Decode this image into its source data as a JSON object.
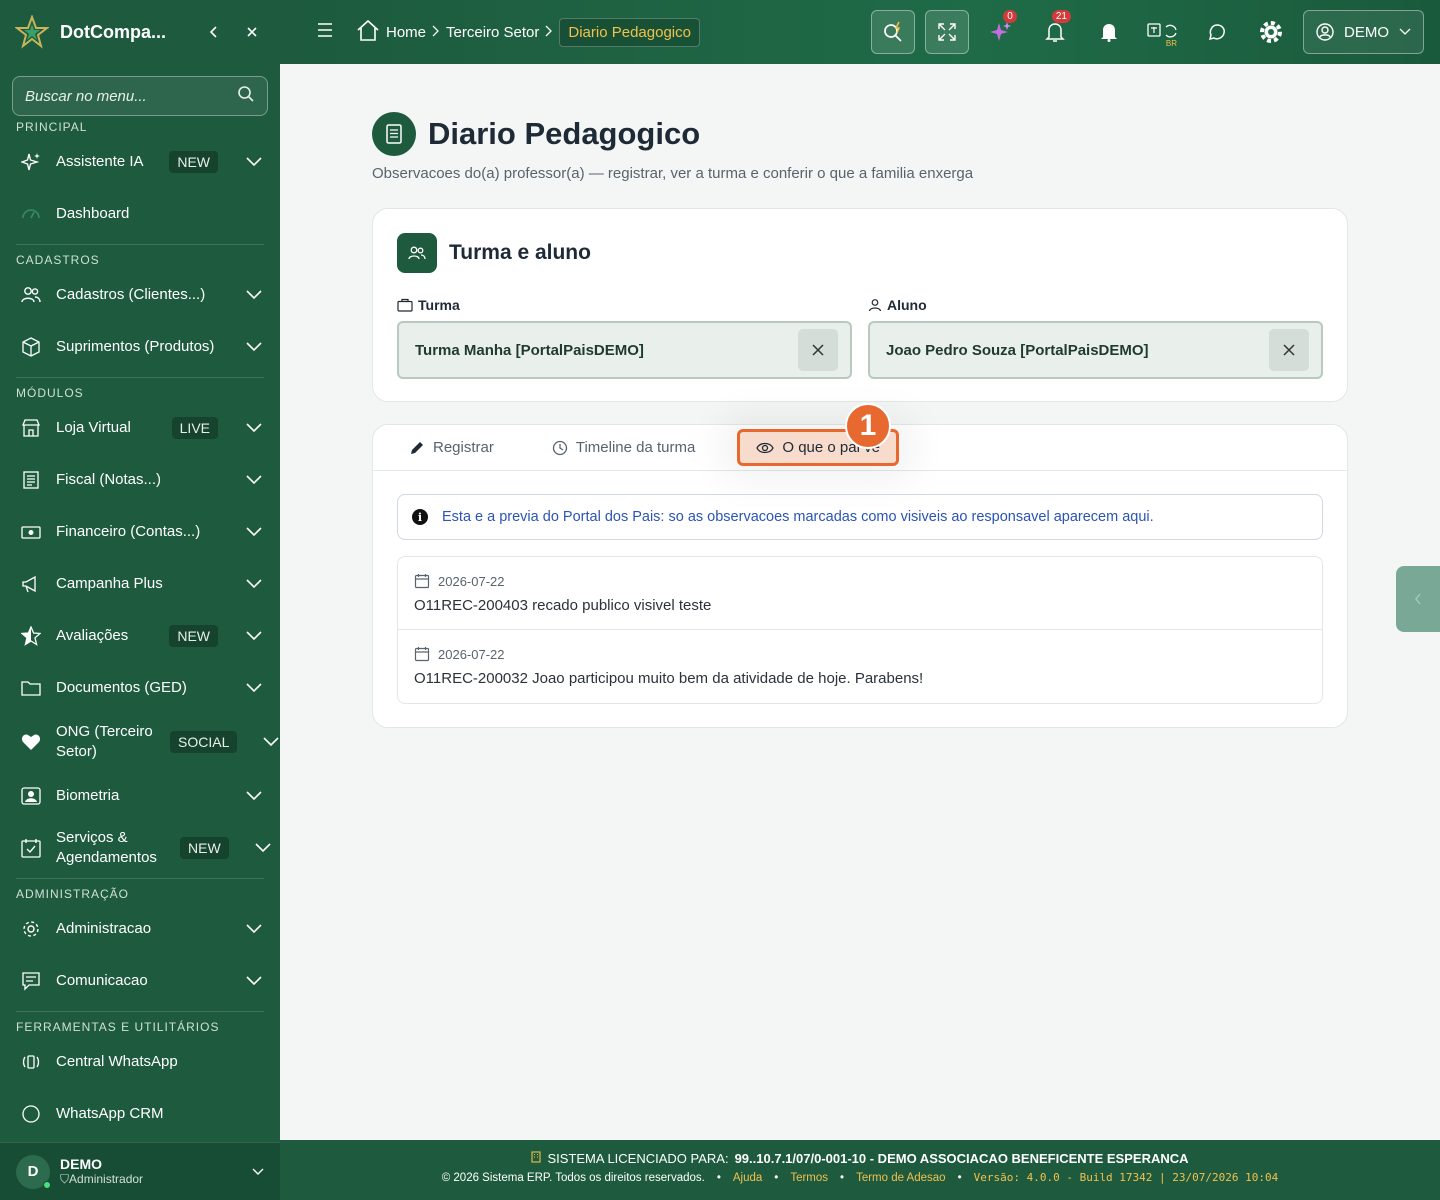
{
  "app": {
    "brand": "DotCompa..."
  },
  "sidebar": {
    "search_placeholder": "Buscar no menu...",
    "sections": {
      "principal": "PRINCIPAL",
      "cadastros": "CADASTROS",
      "modulos": "MÓDULOS",
      "administracao": "ADMINISTRAÇÃO",
      "ferramentas": "FERRAMENTAS E UTILITÁRIOS"
    },
    "items": [
      {
        "label": "Assistente IA",
        "badge": "NEW"
      },
      {
        "label": "Dashboard"
      },
      {
        "label": "Cadastros (Clientes...)"
      },
      {
        "label": "Suprimentos (Produtos)"
      },
      {
        "label": "Loja Virtual",
        "badge": "LIVE"
      },
      {
        "label": "Fiscal (Notas...)"
      },
      {
        "label": "Financeiro (Contas...)"
      },
      {
        "label": "Campanha Plus"
      },
      {
        "label": "Avaliações",
        "badge": "NEW"
      },
      {
        "label": "Documentos (GED)"
      },
      {
        "label": "ONG (Terceiro Setor)",
        "badge": "SOCIAL"
      },
      {
        "label": "Biometria"
      },
      {
        "label": "Serviços & Agendamentos",
        "badge": "NEW"
      },
      {
        "label": "Administracao"
      },
      {
        "label": "Comunicacao"
      },
      {
        "label": "Central WhatsApp"
      },
      {
        "label": "WhatsApp CRM"
      }
    ],
    "user": {
      "initial": "D",
      "name": "DEMO",
      "role": "Administrador"
    }
  },
  "topbar": {
    "breadcrumbs": [
      "Home",
      "Terceiro Setor",
      "Diario Pedagogico"
    ],
    "ai_badge": "0",
    "notif_badge": "21",
    "lang": "BR",
    "user": "DEMO"
  },
  "page": {
    "title": "Diario Pedagogico",
    "subtitle": "Observacoes do(a) professor(a) — registrar, ver a turma e conferir o que a familia enxerga"
  },
  "selection": {
    "title": "Turma e aluno",
    "turma_label": "Turma",
    "turma_value": "Turma Manha [PortalPaisDEMO]",
    "aluno_label": "Aluno",
    "aluno_value": "Joao Pedro Souza [PortalPaisDEMO]"
  },
  "tabs": {
    "items": [
      "Registrar",
      "Timeline da turma",
      "O que o pai ve"
    ],
    "active": "O que o pai ve",
    "marker": "1"
  },
  "preview": {
    "info": "Esta e a previa do Portal dos Pais: so as observacoes marcadas como visiveis ao responsavel aparecem aqui.",
    "observations": [
      {
        "date": "2026-07-22",
        "text": "O11REC-200403 recado publico visivel teste"
      },
      {
        "date": "2026-07-22",
        "text": "O11REC-200032 Joao participou muito bem da atividade de hoje. Parabens!"
      }
    ]
  },
  "footer": {
    "license_label": "SISTEMA LICENCIADO PARA:",
    "license_value": "99..10.7.1/07/0-001-10 - DEMO ASSOCIACAO BENEFICENTE ESPERANCA",
    "copyright": "© 2026 Sistema ERP. Todos os direitos reservados.",
    "links": [
      "Ajuda",
      "Termos",
      "Termo de Adesao"
    ],
    "version": "Versão: 4.0.0 - Build 17342 | 23/07/2026 10:04"
  },
  "colors": {
    "primary": "#1d5a3e",
    "accent": "#e8692f",
    "highlight": "#f2c14e"
  }
}
